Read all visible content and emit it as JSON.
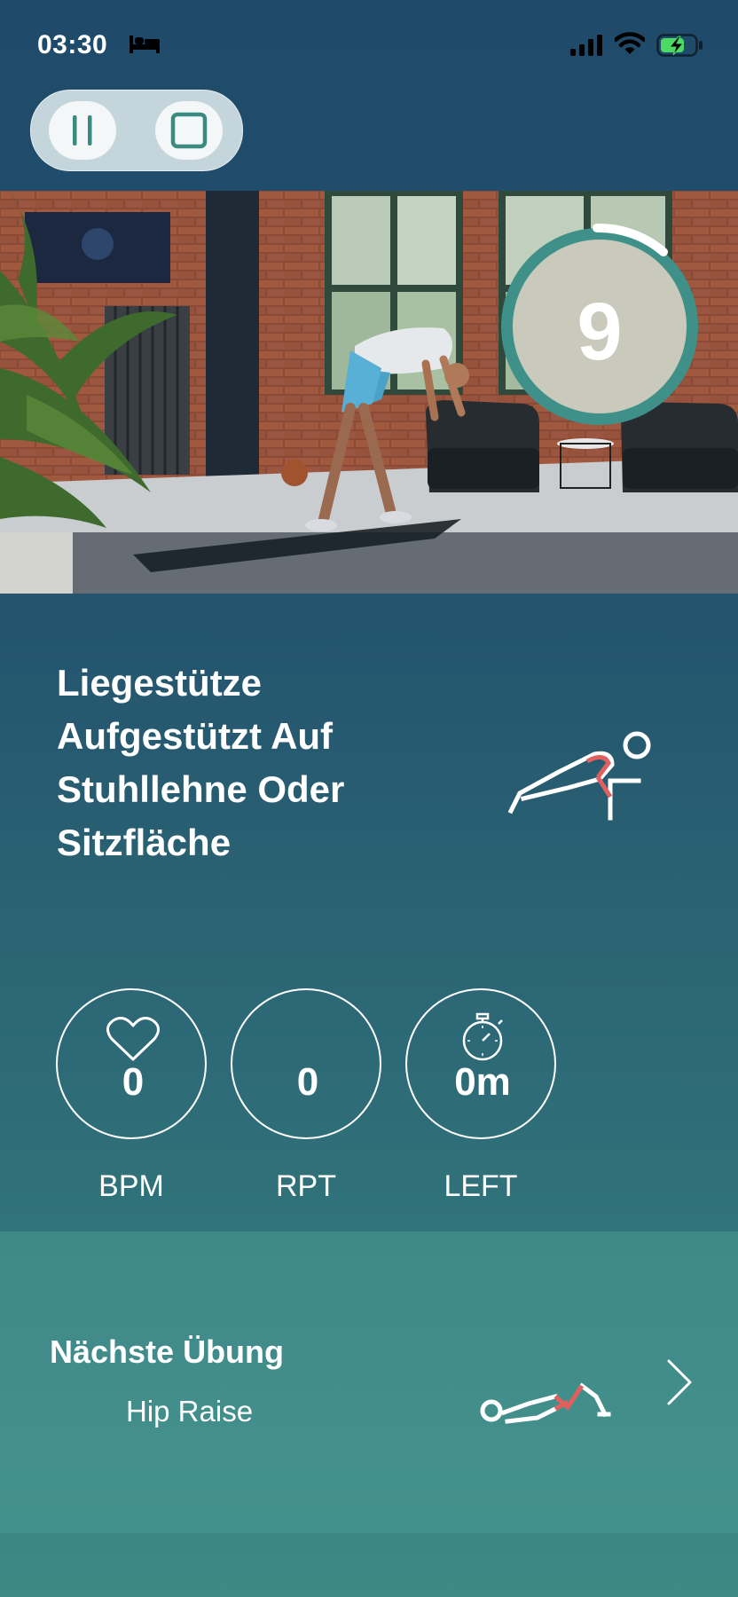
{
  "status_bar": {
    "time": "03:30",
    "icons": [
      "bed-icon",
      "signal-icon",
      "wifi-icon",
      "battery-charging-icon"
    ]
  },
  "controls": {
    "pause_icon": "pause-icon",
    "stop_icon": "stop-icon"
  },
  "countdown": {
    "value": "9",
    "ring_color": "#3f9088"
  },
  "exercise": {
    "title": "Liegestütze Aufgestützt Auf Stuhllehne Oder Sitzfläche"
  },
  "stats": [
    {
      "icon": "heart-icon",
      "value": "0",
      "label": "BPM"
    },
    {
      "icon": "",
      "value": "0",
      "label": "RPT"
    },
    {
      "icon": "stopwatch-icon",
      "value": "0m",
      "label": "LEFT"
    }
  ],
  "next_exercise": {
    "heading": "Nächste Übung",
    "name": "Hip Raise",
    "icon": "chevron-right-icon"
  },
  "colors": {
    "accent": "#3f9088",
    "highlight": "#e06060",
    "background_top": "#1f4a6a",
    "background_bottom": "#3d8a85"
  }
}
